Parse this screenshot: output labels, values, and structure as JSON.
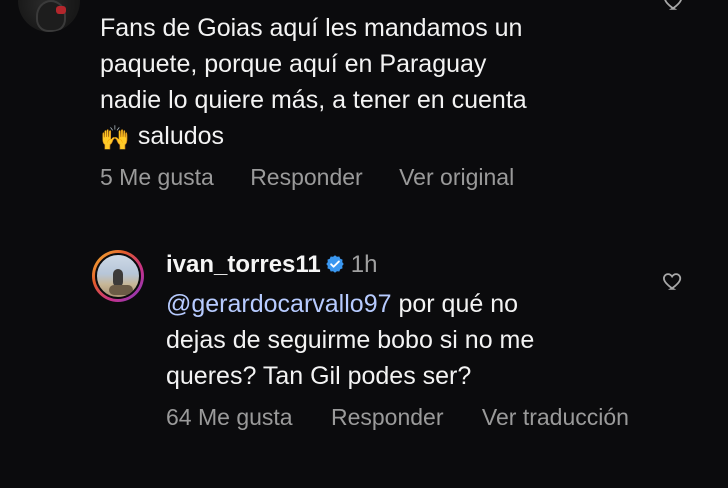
{
  "comments": [
    {
      "text_lines": [
        "Fans de Goias aquí les mandamos un",
        "paquete, porque aquí en Paraguay",
        "nadie lo quiere más, a tener en cuenta",
        "saludos"
      ],
      "emoji": "🙌",
      "actions": {
        "likes": "5 Me gusta",
        "reply": "Responder",
        "see_original": "Ver original"
      }
    }
  ],
  "reply": {
    "username": "ivan_torres11",
    "time": "1h",
    "mention": "@gerardocarvallo97",
    "text_after_mention": " por qué no",
    "text_lines": [
      "dejas de seguirme bobo si no me",
      "queres? Tan Gil podes ser?"
    ],
    "actions": {
      "likes": "64 Me gusta",
      "reply": "Responder",
      "translate": "Ver traducción"
    }
  },
  "icons": {
    "like": "heart-outline-icon",
    "verified": "verified-badge-icon"
  },
  "colors": {
    "background": "#0b0b0d",
    "text": "#f3f3f3",
    "muted": "#9a9a9a",
    "mention": "#b7cbff",
    "verified": "#3a97f0"
  }
}
